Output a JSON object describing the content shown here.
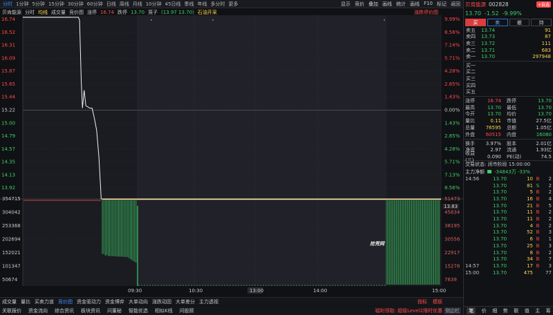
{
  "topbar": {
    "periods": [
      "分时",
      "1分钟",
      "5分钟",
      "15分钟",
      "30分钟",
      "60分钟",
      "日线",
      "周线",
      "月线",
      "10分钟",
      "45日线",
      "季线",
      "年线",
      "多分时",
      "更多"
    ],
    "active_index": 0,
    "right": [
      "显示",
      "竞价",
      "叠加",
      "画线",
      "统计",
      "画线",
      "F10",
      "标记",
      "返回"
    ]
  },
  "titlerow": {
    "name": "贝肯能源",
    "mode1": "分时",
    "mode2": "均线",
    "mode3": "成交量",
    "mode4": "竞价图",
    "limit_up_label": "涨停",
    "limit_up": "16.74",
    "limit_down_label": "跌停",
    "limit_down": "13.70",
    "wave_label": "笼子",
    "wave": "(13.97 13.70)",
    "note": "石油开采",
    "right_note": "涨跌停价图"
  },
  "chart_data": {
    "type": "line",
    "title": "",
    "price_axis": {
      "ylim": [
        13.7,
        16.74
      ],
      "ticks": [
        "16.74",
        "16.52",
        "16.31",
        "16.09",
        "15.87",
        "15.65",
        "15.44",
        "15.22",
        "15.00",
        "14.79",
        "14.57",
        "14.35",
        "14.13",
        "13.92"
      ],
      "pct_ticks": [
        "9.99%",
        "8.56%",
        "7.14%",
        "5.71%",
        "4.28%",
        "2.85%",
        "1.43%",
        "0.00%",
        "1.43%",
        "2.85%",
        "4.28%",
        "5.71%",
        "7.13%",
        "8.56%"
      ],
      "prev_close": "15.22",
      "current_price_label": "13.83"
    },
    "volume_axis": {
      "left_ticks": [
        "354715",
        "304042",
        "253368",
        "202694",
        "152021",
        "101347",
        "50674"
      ],
      "right_ticks": [
        "51473",
        "45834",
        "38195",
        "30556",
        "22917",
        "15278",
        "7639"
      ]
    },
    "x_ticks": [
      "09:30",
      "10:30",
      "13:00",
      "14:00",
      "15:00"
    ],
    "auction_price": [
      {
        "t": 0.0,
        "p": 16.74
      },
      {
        "t": 0.98,
        "p": 16.74
      },
      {
        "t": 1.0,
        "p": 16.69
      },
      {
        "t": 1.03,
        "p": 15.65
      },
      {
        "t": 1.05,
        "p": 15.22
      },
      {
        "t": 1.08,
        "p": 15.52
      },
      {
        "t": 1.11,
        "p": 15.26
      },
      {
        "t": 1.18,
        "p": 15.22
      },
      {
        "t": 1.22,
        "p": 15.22
      },
      {
        "t": 1.26,
        "p": 15.05
      },
      {
        "t": 1.3,
        "p": 14.85
      },
      {
        "t": 1.34,
        "p": 14.4
      },
      {
        "t": 1.38,
        "p": 13.7
      },
      {
        "t": 1.4,
        "p": 13.7
      }
    ],
    "session_price": 13.7,
    "session_avg": 13.7,
    "auction_volume_profile": [
      0.6,
      0.62,
      0.62,
      0.65,
      0.66,
      0.68,
      0.7,
      0.72,
      0.74,
      0.76,
      0.78,
      0.8,
      0.82,
      0.84,
      0.86,
      0.88,
      0.9,
      0.92,
      0.93,
      0.94,
      0.95,
      0.96,
      0.97,
      0.98
    ],
    "close_volume_level": 0.98
  },
  "panel": {
    "name": "贝肯能源",
    "code": "002828",
    "add_label": "+自选",
    "price": "13.70",
    "change": "-1.52",
    "pct": "-9.99%",
    "buttons": [
      "买",
      "卖",
      "撤",
      "持"
    ],
    "asks": [
      {
        "label": "卖五",
        "price": "13.74",
        "vol": "91"
      },
      {
        "label": "卖四",
        "price": "13.73",
        "vol": "87"
      },
      {
        "label": "卖三",
        "price": "13.72",
        "vol": "111"
      },
      {
        "label": "卖二",
        "price": "13.71",
        "vol": "683"
      },
      {
        "label": "卖一",
        "price": "13.70",
        "vol": "297948"
      }
    ],
    "bids": [
      {
        "label": "买一",
        "price": "",
        "vol": ""
      },
      {
        "label": "买二",
        "price": "",
        "vol": ""
      },
      {
        "label": "买三",
        "price": "",
        "vol": ""
      },
      {
        "label": "买四",
        "price": "",
        "vol": ""
      },
      {
        "label": "买五",
        "price": "",
        "vol": ""
      }
    ],
    "quote": [
      {
        "l": "涨停",
        "v": "16.74",
        "vc": "r",
        "l2": "跌停",
        "v2": "13.70",
        "v2c": "g"
      },
      {
        "l": "最高",
        "v": "13.70",
        "vc": "g",
        "l2": "最低",
        "v2": "13.70",
        "v2c": "g"
      },
      {
        "l": "今开",
        "v": "13.70",
        "vc": "g",
        "l2": "均价",
        "v2": "13.70",
        "v2c": "g"
      },
      {
        "l": "量比",
        "v": "0.11",
        "vc": "y",
        "l2": "市值",
        "v2": "27.5亿",
        "v2c": "w"
      },
      {
        "l": "总量",
        "v": "76595",
        "vc": "y",
        "l2": "总额",
        "v2": "1.05亿",
        "v2c": "w"
      },
      {
        "l": "外盘",
        "v": "60515",
        "vc": "r",
        "l2": "内盘",
        "v2": "16080",
        "v2c": "g"
      }
    ],
    "quote2": [
      {
        "l": "换手",
        "v": "3.97%",
        "vc": "w",
        "l2": "股本",
        "v2": "2.01亿",
        "v2c": "w"
      },
      {
        "l": "净资",
        "v": "2.97",
        "vc": "w",
        "l2": "流通",
        "v2": "1.93亿",
        "v2c": "w"
      },
      {
        "l": "收益(三)",
        "v": "0.090",
        "vc": "w",
        "l2": "PE(动)",
        "v2": "74.5",
        "v2c": "w"
      }
    ],
    "status": "交易状态: 闭市阶段 15:00:00",
    "money_flow_label": "主力净额",
    "money_flow_value": "-34843万 -33%",
    "trades": [
      {
        "t": "14:56",
        "p": "13.70",
        "v": "10",
        "bs": "B",
        "n": "2"
      },
      {
        "t": "",
        "p": "13.70",
        "v": "81",
        "bs": "S",
        "n": "2"
      },
      {
        "t": "",
        "p": "13.70",
        "v": "5",
        "bs": "B",
        "n": "2"
      },
      {
        "t": "",
        "p": "13.70",
        "v": "16",
        "bs": "B",
        "n": "4"
      },
      {
        "t": "",
        "p": "13.70",
        "v": "21",
        "bs": "B",
        "n": "5"
      },
      {
        "t": "",
        "p": "13.70",
        "v": "11",
        "bs": "B",
        "n": "2"
      },
      {
        "t": "",
        "p": "13.70",
        "v": "11",
        "bs": "B",
        "n": "2"
      },
      {
        "t": "",
        "p": "13.70",
        "v": "4",
        "bs": "B",
        "n": "2"
      },
      {
        "t": "",
        "p": "13.70",
        "v": "52",
        "bs": "B",
        "n": "3"
      },
      {
        "t": "",
        "p": "13.70",
        "v": "6",
        "bs": "B",
        "n": "1"
      },
      {
        "t": "",
        "p": "13.70",
        "v": "25",
        "bs": "B",
        "n": "3"
      },
      {
        "t": "",
        "p": "13.70",
        "v": "8",
        "bs": "B",
        "n": "2"
      },
      {
        "t": "",
        "p": "13.70",
        "v": "34",
        "bs": "B",
        "n": "7"
      },
      {
        "t": "14:57",
        "p": "13.70",
        "v": "17",
        "bs": "B",
        "n": "3"
      },
      {
        "t": "15:00",
        "p": "13.70",
        "v": "475",
        "bs": "",
        "n": "77"
      }
    ],
    "footer": [
      "笔",
      "价",
      "细",
      "势",
      "联",
      "值",
      "主",
      "筹"
    ],
    "footer_active": 0
  },
  "tabs1": {
    "items": [
      "成交量",
      "量比",
      "买卖力道",
      "竞价图",
      "资金驱动力",
      "资金博弈",
      "大单动向",
      "涨跌动因",
      "大单差分",
      "主力透视"
    ],
    "active_index": 3,
    "right": [
      "指标",
      "模板"
    ]
  },
  "tabs2": {
    "items": [
      "关联报价",
      "资金流向",
      "综合资讯",
      "板块资讯",
      "问董秘",
      "智能优选",
      "相似K线",
      "问股顾"
    ],
    "promo": "福利领取: 超级Level2限时优惠",
    "promo2": "侧边栏"
  },
  "watermark": "拾荒网"
}
